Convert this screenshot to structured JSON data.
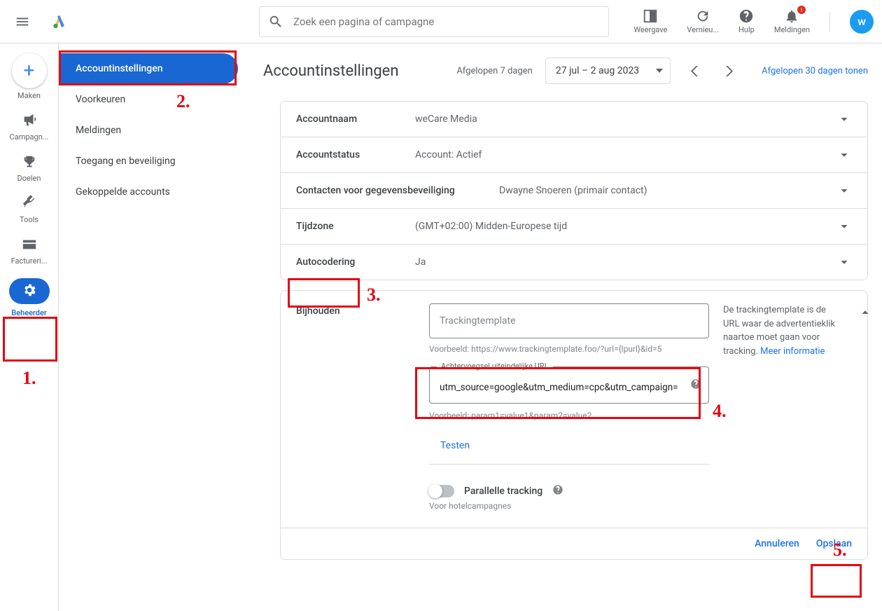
{
  "header": {
    "search_placeholder": "Zoek een pagina of campagne",
    "actions": {
      "weergave": "Weergave",
      "vernieuw": "Vernieu...",
      "hulp": "Hulp",
      "meldingen": "Meldingen",
      "avatar_letter": "w"
    }
  },
  "rail": {
    "maken": "Maken",
    "campagnes": "Campagn...",
    "doelen": "Doelen",
    "tools": "Tools",
    "facturering": "Factureri...",
    "beheerder": "Beheerder"
  },
  "secnav": {
    "accountinstellingen": "Accountinstellingen",
    "voorkeuren": "Voorkeuren",
    "meldingen": "Meldingen",
    "toegang": "Toegang en beveiliging",
    "gekoppeld": "Gekoppelde accounts"
  },
  "main": {
    "title": "Accountinstellingen",
    "date_label": "Afgelopen 7 dagen",
    "date_range": "27 jul – 2 aug 2023",
    "compare": "Afgelopen 30 dagen tonen",
    "rows": {
      "accountnaam_label": "Accountnaam",
      "accountnaam_value": "weCare Media",
      "status_label": "Accountstatus",
      "status_value": "Account: Actief",
      "contact_label": "Contacten voor gegevensbeveiliging",
      "contact_value": "Dwayne Snoeren (primair contact)",
      "tijdzone_label": "Tijdzone",
      "tijdzone_value": "(GMT+02:00) Midden-Europese tijd",
      "auto_label": "Autocodering",
      "auto_value": "Ja"
    },
    "track": {
      "section_label": "Bijhouden",
      "template_placeholder": "Trackingtemplate",
      "template_example": "Voorbeeld: https://www.trackingtemplate.foo/?url={lpurl}&id=5",
      "suffix_label": "Achtervoegsel uiteindelijke URL",
      "suffix_value": "utm_source=google&utm_medium=cpc&utm_campaign=",
      "suffix_example": "Voorbeeld: param1=value1&param2=value2",
      "test": "Testen",
      "parallel": "Parallelle tracking",
      "parallel_sub": "Voor hotelcampagnes",
      "help_text": "De trackingtemplate is de URL waar de advertentieklik naartoe moet gaan voor tracking. ",
      "help_link": "Meer informatie",
      "cancel": "Annuleren",
      "save": "Opslaan"
    }
  },
  "annotations": {
    "a1": "1.",
    "a2": "2.",
    "a3": "3.",
    "a4": "4.",
    "a5": "5."
  }
}
